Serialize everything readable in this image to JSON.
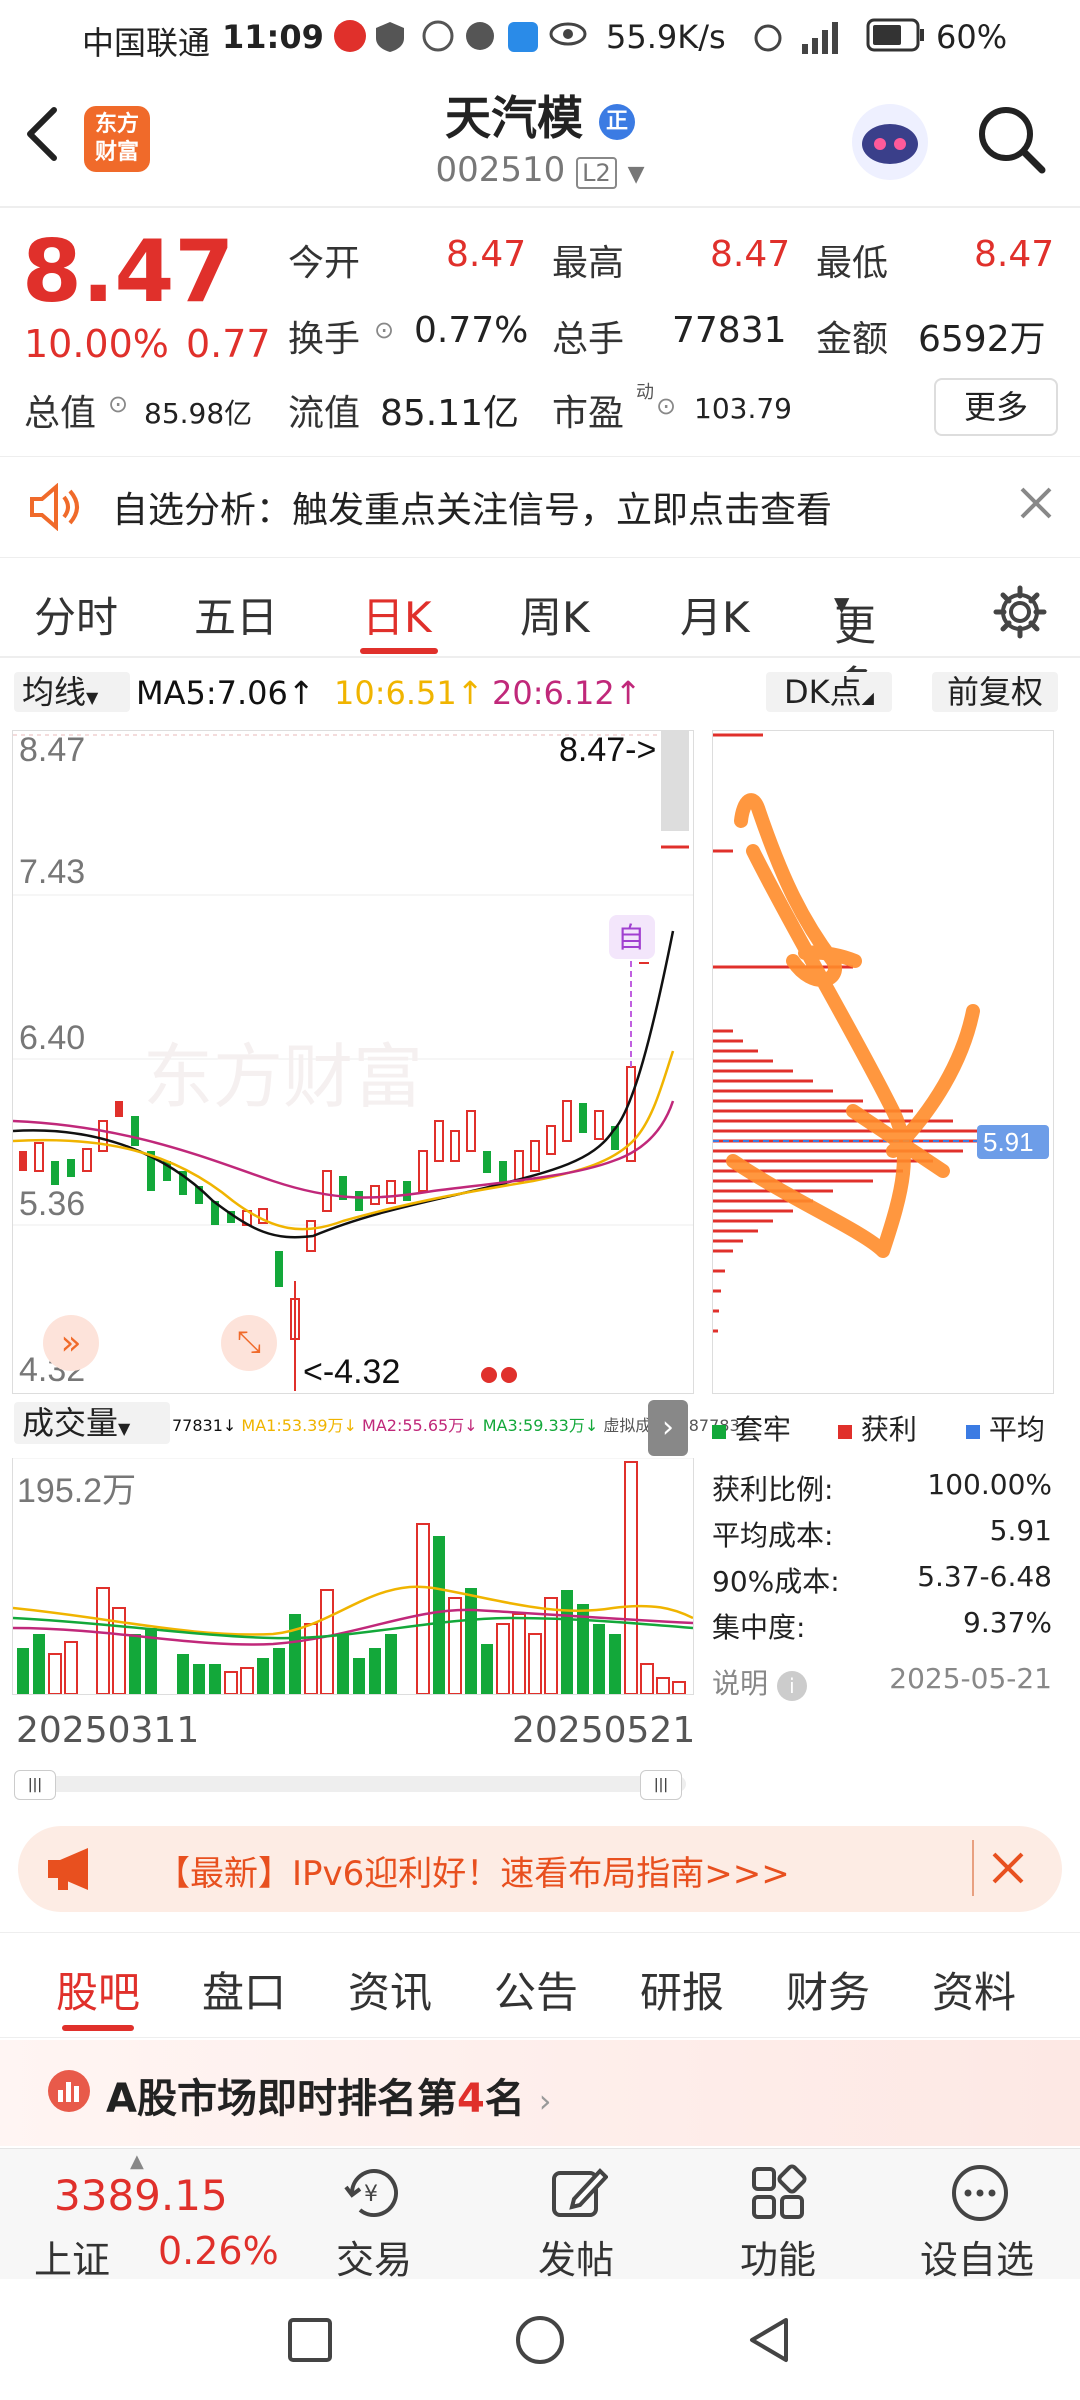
{
  "status": {
    "carrier": "中国联通",
    "time": "11:09",
    "speed": "55.9K/s",
    "battery": "60%"
  },
  "header": {
    "logo_text": "东方财富",
    "title": "天汽模",
    "title_badge": "正",
    "code": "002510",
    "level": "L2"
  },
  "quote": {
    "price": "8.47",
    "change_pct": "10.00%",
    "change": "0.77",
    "open_label": "今开",
    "open": "8.47",
    "high_label": "最高",
    "high": "8.47",
    "low_label": "最低",
    "low": "8.47",
    "turnover_label": "换手",
    "turnover": "0.77%",
    "volume_label": "总手",
    "volume": "77831",
    "amount_label": "金额",
    "amount": "6592万",
    "mktcap_label": "总值",
    "mktcap": "85.98亿",
    "float_label": "流值",
    "float": "85.11亿",
    "pe_label": "市盈",
    "pe_sup": "动",
    "pe": "103.79",
    "more": "更多"
  },
  "notice": {
    "text": "自选分析：触发重点关注信号，立即点击查看"
  },
  "tabs": [
    "分时",
    "五日",
    "日K",
    "周K",
    "月K",
    "更多"
  ],
  "ma_bar": {
    "selector": "均线",
    "ma5": "MA5:7.06↑",
    "ma10": "10:6.51↑",
    "ma20": "20:6.12↑",
    "dk": "DK点",
    "adjust": "前复权"
  },
  "kline": {
    "price_labels": [
      "8.47",
      "7.43",
      "6.40",
      "5.36",
      "4.32"
    ],
    "high_marker": "8.47->",
    "low_marker": "<-4.32",
    "self_tag": "自",
    "watermark": "东方财富"
  },
  "volume": {
    "selector": "成交量",
    "legend_vol": "77831↓",
    "legend_ma1": "MA1:53.39万↓",
    "legend_ma2": "MA2:55.65万↓",
    "legend_ma3": "MA3:59.33万↓",
    "legend_virtual": "虚拟成交量:87783",
    "max_label": "195.2万",
    "date_start": "20250311",
    "date_end": "20250521"
  },
  "chips": {
    "avg_tag": "5.91",
    "legend_trapped": "套牢",
    "legend_profit": "获利",
    "legend_avg": "平均",
    "profit_ratio_label": "获利比例:",
    "profit_ratio": "100.00%",
    "avg_cost_label": "平均成本:",
    "avg_cost": "5.91",
    "cost90_label": "90%成本:",
    "cost90": "5.37-6.48",
    "concentration_label": "集中度:",
    "concentration": "9.37%",
    "note_label": "说明",
    "date": "2025-05-21"
  },
  "promo": {
    "text": "【最新】IPv6迎利好！速看布局指南>>>"
  },
  "bottom_tabs": [
    "股吧",
    "盘口",
    "资讯",
    "公告",
    "研报",
    "财务",
    "资料"
  ],
  "rank": {
    "text_prefix": "A股市场即时排名第",
    "rank": "4",
    "text_suffix": "名"
  },
  "nav": {
    "index_value": "3389.15",
    "index_name": "上证",
    "index_change": "0.26%",
    "items": [
      "交易",
      "发帖",
      "功能",
      "设自选"
    ]
  },
  "colors": {
    "up": "#e0302b",
    "down": "#13a83a",
    "accent": "#f06a2a",
    "ma5": "#111111",
    "ma10": "#f0b400",
    "ma20": "#c0287a"
  }
}
